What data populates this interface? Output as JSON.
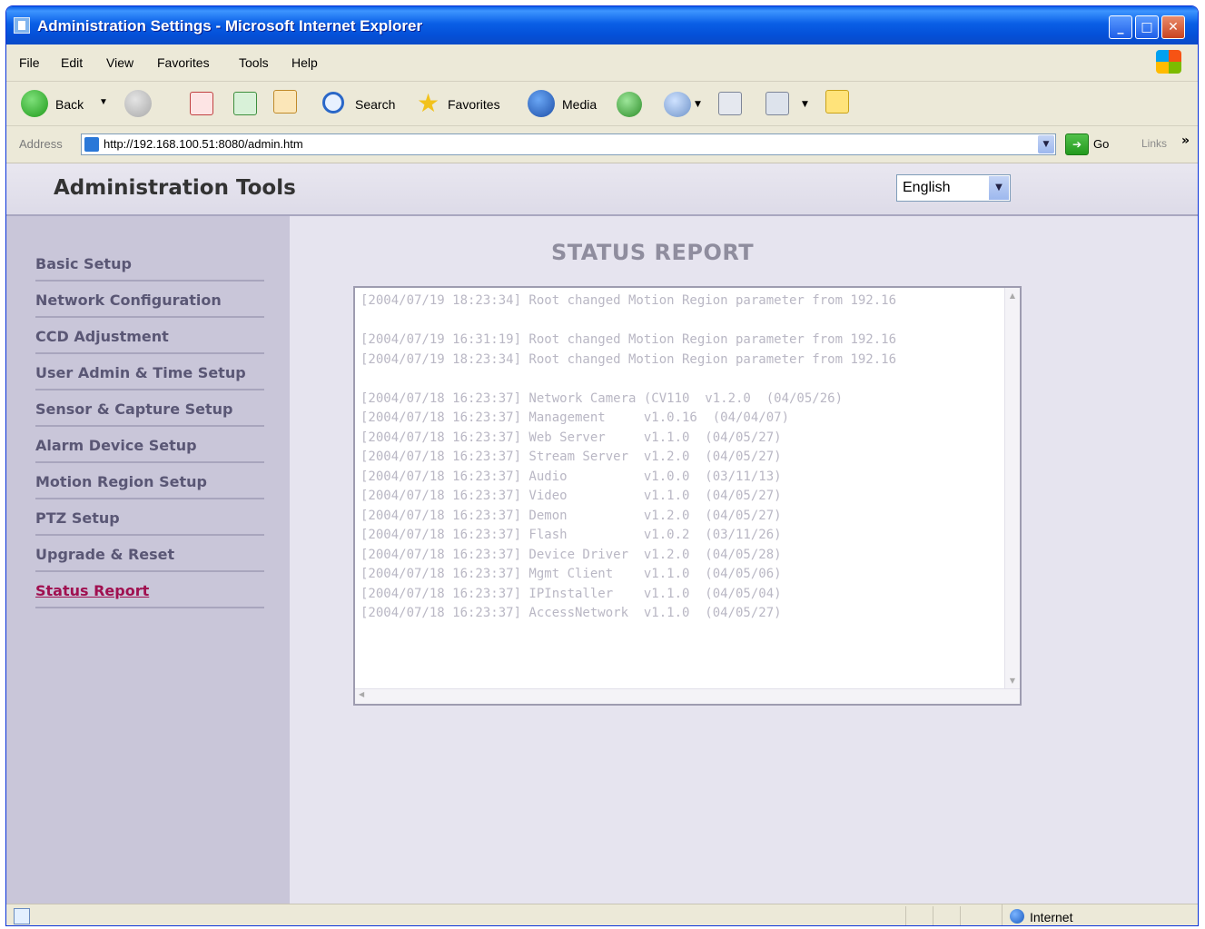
{
  "window": {
    "title": "Administration Settings - Microsoft Internet Explorer",
    "min_label": "_",
    "max_label": "□",
    "close_label": "✕"
  },
  "menu": [
    "File",
    "Edit",
    "View",
    "Favorites",
    "Tools",
    "Help"
  ],
  "toolbar": {
    "back": "Back",
    "search": "Search",
    "favorites": "Favorites",
    "media": "Media"
  },
  "address": {
    "label": "Address",
    "url": "http://192.168.100.51:8080/admin.htm",
    "go": "Go",
    "links": "Links"
  },
  "header": {
    "title": "Administration Tools",
    "language": "English"
  },
  "sidebar": {
    "items": [
      {
        "label": "Basic Setup"
      },
      {
        "label": "Network Configuration"
      },
      {
        "label": "CCD Adjustment"
      },
      {
        "label": "User Admin & Time Setup"
      },
      {
        "label": "Sensor & Capture Setup"
      },
      {
        "label": "Alarm Device Setup"
      },
      {
        "label": "Motion Region Setup"
      },
      {
        "label": "PTZ Setup"
      },
      {
        "label": "Upgrade & Reset"
      },
      {
        "label": "Status Report",
        "active": true
      }
    ]
  },
  "main": {
    "title": "STATUS REPORT",
    "log": "[2004/07/19 18:23:34] Root changed Motion Region parameter from 192.16\n\n[2004/07/19 16:31:19] Root changed Motion Region parameter from 192.16\n[2004/07/19 18:23:34] Root changed Motion Region parameter from 192.16\n\n[2004/07/18 16:23:37] Network Camera (CV110  v1.2.0  (04/05/26)\n[2004/07/18 16:23:37] Management     v1.0.16  (04/04/07)\n[2004/07/18 16:23:37] Web Server     v1.1.0  (04/05/27)\n[2004/07/18 16:23:37] Stream Server  v1.2.0  (04/05/27)\n[2004/07/18 16:23:37] Audio          v1.0.0  (03/11/13)\n[2004/07/18 16:23:37] Video          v1.1.0  (04/05/27)\n[2004/07/18 16:23:37] Demon          v1.2.0  (04/05/27)\n[2004/07/18 16:23:37] Flash          v1.0.2  (03/11/26)\n[2004/07/18 16:23:37] Device Driver  v1.2.0  (04/05/28)\n[2004/07/18 16:23:37] Mgmt Client    v1.1.0  (04/05/06)\n[2004/07/18 16:23:37] IPInstaller    v1.1.0  (04/05/04)\n[2004/07/18 16:23:37] AccessNetwork  v1.1.0  (04/05/27)"
  },
  "status": {
    "zone": "Internet"
  },
  "colors": {
    "titlebar": "#0450d8",
    "chrome": "#ece9d8",
    "sidebar": "#c9c6d9",
    "content_bg": "#e6e4ef",
    "active_link": "#a01050"
  },
  "icons": [
    "app-icon",
    "windows-logo-icon",
    "back-icon",
    "forward-icon",
    "stop-icon",
    "refresh-icon",
    "home-icon",
    "search-icon",
    "favorites-icon",
    "media-icon",
    "history-icon",
    "mail-icon",
    "print-icon",
    "edit-icon",
    "messenger-icon",
    "page-icon",
    "go-icon",
    "globe-icon"
  ]
}
